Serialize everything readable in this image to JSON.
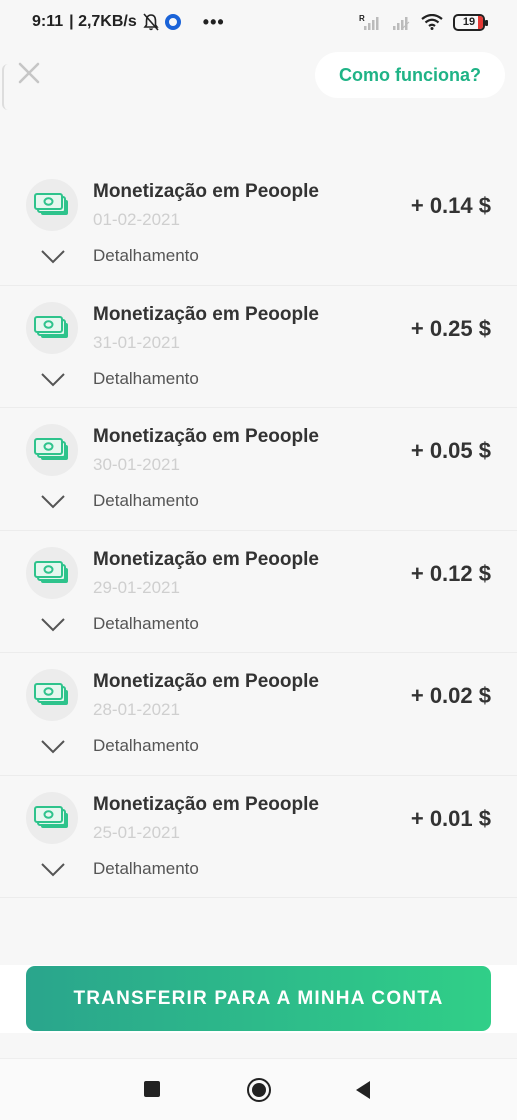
{
  "status_bar": {
    "time": "9:11",
    "network_speed": "| 2,7KB/s",
    "more": "•••",
    "battery_level": "19",
    "colors": {
      "ring": "#1a63d8",
      "battery_low": "#e53935"
    }
  },
  "header": {
    "close_icon": "close-icon",
    "how_it_works_label": "Como funciona?"
  },
  "transactions": [
    {
      "title": "Monetização em Peoople",
      "date": "01-02-2021",
      "amount": "+ 0.14 $",
      "detail_label": "Detalhamento"
    },
    {
      "title": "Monetização em Peoople",
      "date": "31-01-2021",
      "amount": "+ 0.25 $",
      "detail_label": "Detalhamento"
    },
    {
      "title": "Monetização em Peoople",
      "date": "30-01-2021",
      "amount": "+ 0.05 $",
      "detail_label": "Detalhamento"
    },
    {
      "title": "Monetização em Peoople",
      "date": "29-01-2021",
      "amount": "+ 0.12 $",
      "detail_label": "Detalhamento"
    },
    {
      "title": "Monetização em Peoople",
      "date": "28-01-2021",
      "amount": "+ 0.02 $",
      "detail_label": "Detalhamento"
    },
    {
      "title": "Monetização em Peoople",
      "date": "25-01-2021",
      "amount": "+ 0.01 $",
      "detail_label": "Detalhamento"
    }
  ],
  "cta": {
    "label": "TRANSFERIR PARA A MINHA CONTA"
  },
  "theme": {
    "accent": "#1fb386",
    "cta_gradient_start": "#2aa58c",
    "cta_gradient_end": "#30cf88",
    "money_icon": "#2ec38c"
  }
}
